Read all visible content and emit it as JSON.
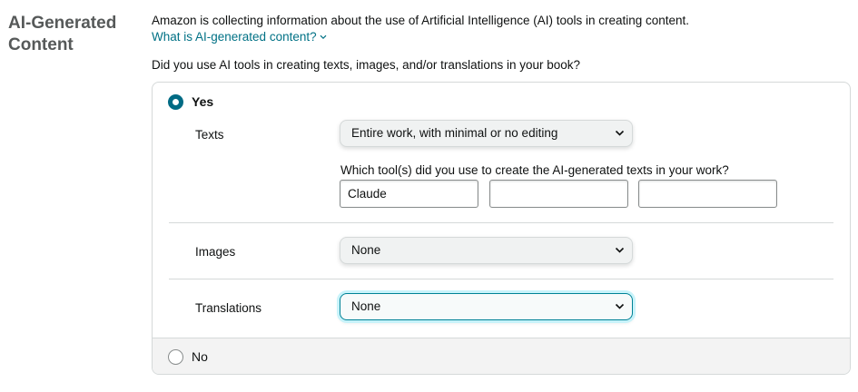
{
  "section": {
    "title": "AI-Generated Content"
  },
  "intro": {
    "text": "Amazon is collecting information about the use of Artificial Intelligence (AI) tools in creating content.",
    "link_label": "What is AI-generated content?",
    "link_icon": "chevron-down-icon"
  },
  "question": "Did you use AI tools in creating texts, images, and/or translations in your book?",
  "options": {
    "yes_label": "Yes",
    "no_label": "No",
    "selected": "Yes"
  },
  "texts": {
    "label": "Texts",
    "selected_value": "Entire work, with minimal or no editing",
    "tools_question": "Which tool(s) did you use to create the AI-generated texts in your work?",
    "tool_inputs": [
      "Claude",
      "",
      ""
    ]
  },
  "images": {
    "label": "Images",
    "selected_value": "None"
  },
  "translations": {
    "label": "Translations",
    "selected_value": "None"
  },
  "colors": {
    "link": "#007185",
    "radio_selected": "#016b84",
    "focus_ring": "#008296"
  }
}
